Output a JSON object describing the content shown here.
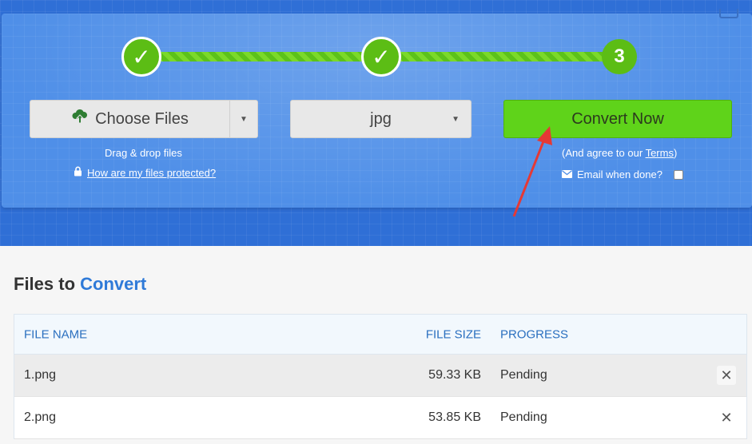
{
  "steps": {
    "step1_glyph": "✓",
    "step2_glyph": "✓",
    "step3_label": "3"
  },
  "controls": {
    "choose_files_label": "Choose Files",
    "choose_icon": "cloud-upload-icon",
    "format_value": "jpg",
    "convert_label": "Convert Now",
    "drag_drop_text": "Drag & drop files",
    "protect_link": "How are my files protected?",
    "agree_prefix": "(And agree to our ",
    "agree_terms": "Terms",
    "agree_suffix": ")",
    "email_label": "Email when done?"
  },
  "files_section": {
    "title_prefix": "Files to ",
    "title_accent": "Convert",
    "columns": [
      "FILE NAME",
      "FILE SIZE",
      "PROGRESS"
    ],
    "rows": [
      {
        "name": "1.png",
        "size": "59.33 KB",
        "progress": "Pending"
      },
      {
        "name": "2.png",
        "size": "53.85 KB",
        "progress": "Pending"
      }
    ]
  },
  "colors": {
    "band": "#2f6fd6",
    "panel": "#4f8fe8",
    "step_green": "#5cbd15",
    "convert_green": "#5fd31a",
    "accent_blue": "#2f7ad8",
    "annotation_red": "#e53935"
  }
}
